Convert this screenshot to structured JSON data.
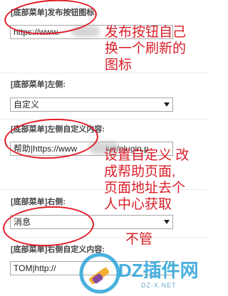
{
  "settings": [
    {
      "label": "[底部菜单]发布按钮图标:",
      "value": "https://www."
    },
    {
      "label": "[底部菜单]左侧:",
      "value": "自定义"
    },
    {
      "label": "[底部菜单]左侧自定义内容:",
      "value": "帮助|https://www",
      "value_tail": "ive/plugin.p"
    },
    {
      "label": "[底部菜单]右侧:",
      "value": "消息"
    },
    {
      "label": "[底部菜单]右侧自定义内容:",
      "value": "TOM|http://"
    }
  ],
  "annotations": {
    "note1": [
      "发布按钮自己",
      "换一个刷新的",
      "图标"
    ],
    "note2": [
      "设置自定义 改",
      "成帮助页面,",
      "页面地址去个",
      "人中心获取"
    ],
    "note3": "不管"
  },
  "watermark": {
    "brand": "DZ插件网",
    "url": "DZ-X.NET"
  },
  "colors": {
    "annotation": "#e11d27",
    "watermark": "#2aa3d8"
  }
}
